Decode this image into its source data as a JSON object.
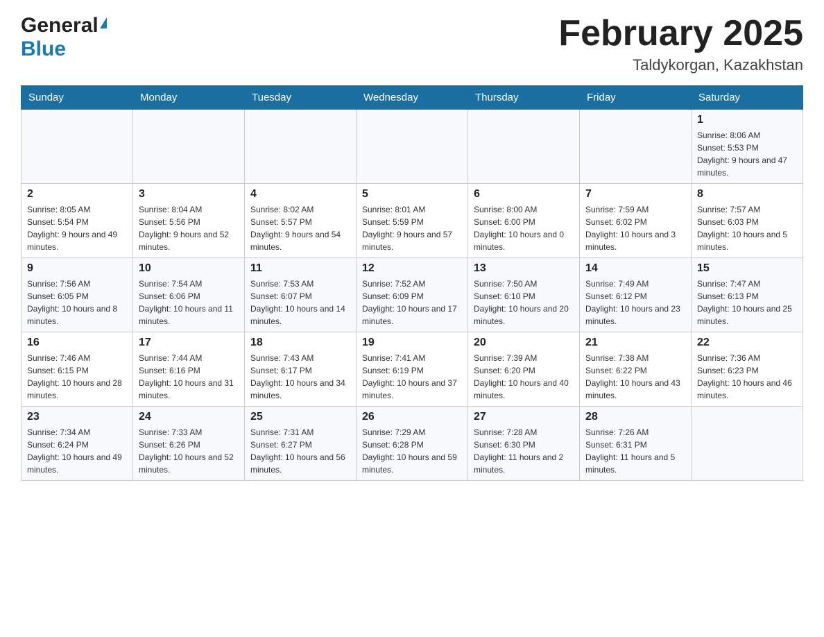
{
  "header": {
    "logo_general": "General",
    "logo_blue": "Blue",
    "title": "February 2025",
    "subtitle": "Taldykorgan, Kazakhstan"
  },
  "days_of_week": [
    "Sunday",
    "Monday",
    "Tuesday",
    "Wednesday",
    "Thursday",
    "Friday",
    "Saturday"
  ],
  "weeks": [
    [
      {
        "day": "",
        "info": ""
      },
      {
        "day": "",
        "info": ""
      },
      {
        "day": "",
        "info": ""
      },
      {
        "day": "",
        "info": ""
      },
      {
        "day": "",
        "info": ""
      },
      {
        "day": "",
        "info": ""
      },
      {
        "day": "1",
        "info": "Sunrise: 8:06 AM\nSunset: 5:53 PM\nDaylight: 9 hours and 47 minutes."
      }
    ],
    [
      {
        "day": "2",
        "info": "Sunrise: 8:05 AM\nSunset: 5:54 PM\nDaylight: 9 hours and 49 minutes."
      },
      {
        "day": "3",
        "info": "Sunrise: 8:04 AM\nSunset: 5:56 PM\nDaylight: 9 hours and 52 minutes."
      },
      {
        "day": "4",
        "info": "Sunrise: 8:02 AM\nSunset: 5:57 PM\nDaylight: 9 hours and 54 minutes."
      },
      {
        "day": "5",
        "info": "Sunrise: 8:01 AM\nSunset: 5:59 PM\nDaylight: 9 hours and 57 minutes."
      },
      {
        "day": "6",
        "info": "Sunrise: 8:00 AM\nSunset: 6:00 PM\nDaylight: 10 hours and 0 minutes."
      },
      {
        "day": "7",
        "info": "Sunrise: 7:59 AM\nSunset: 6:02 PM\nDaylight: 10 hours and 3 minutes."
      },
      {
        "day": "8",
        "info": "Sunrise: 7:57 AM\nSunset: 6:03 PM\nDaylight: 10 hours and 5 minutes."
      }
    ],
    [
      {
        "day": "9",
        "info": "Sunrise: 7:56 AM\nSunset: 6:05 PM\nDaylight: 10 hours and 8 minutes."
      },
      {
        "day": "10",
        "info": "Sunrise: 7:54 AM\nSunset: 6:06 PM\nDaylight: 10 hours and 11 minutes."
      },
      {
        "day": "11",
        "info": "Sunrise: 7:53 AM\nSunset: 6:07 PM\nDaylight: 10 hours and 14 minutes."
      },
      {
        "day": "12",
        "info": "Sunrise: 7:52 AM\nSunset: 6:09 PM\nDaylight: 10 hours and 17 minutes."
      },
      {
        "day": "13",
        "info": "Sunrise: 7:50 AM\nSunset: 6:10 PM\nDaylight: 10 hours and 20 minutes."
      },
      {
        "day": "14",
        "info": "Sunrise: 7:49 AM\nSunset: 6:12 PM\nDaylight: 10 hours and 23 minutes."
      },
      {
        "day": "15",
        "info": "Sunrise: 7:47 AM\nSunset: 6:13 PM\nDaylight: 10 hours and 25 minutes."
      }
    ],
    [
      {
        "day": "16",
        "info": "Sunrise: 7:46 AM\nSunset: 6:15 PM\nDaylight: 10 hours and 28 minutes."
      },
      {
        "day": "17",
        "info": "Sunrise: 7:44 AM\nSunset: 6:16 PM\nDaylight: 10 hours and 31 minutes."
      },
      {
        "day": "18",
        "info": "Sunrise: 7:43 AM\nSunset: 6:17 PM\nDaylight: 10 hours and 34 minutes."
      },
      {
        "day": "19",
        "info": "Sunrise: 7:41 AM\nSunset: 6:19 PM\nDaylight: 10 hours and 37 minutes."
      },
      {
        "day": "20",
        "info": "Sunrise: 7:39 AM\nSunset: 6:20 PM\nDaylight: 10 hours and 40 minutes."
      },
      {
        "day": "21",
        "info": "Sunrise: 7:38 AM\nSunset: 6:22 PM\nDaylight: 10 hours and 43 minutes."
      },
      {
        "day": "22",
        "info": "Sunrise: 7:36 AM\nSunset: 6:23 PM\nDaylight: 10 hours and 46 minutes."
      }
    ],
    [
      {
        "day": "23",
        "info": "Sunrise: 7:34 AM\nSunset: 6:24 PM\nDaylight: 10 hours and 49 minutes."
      },
      {
        "day": "24",
        "info": "Sunrise: 7:33 AM\nSunset: 6:26 PM\nDaylight: 10 hours and 52 minutes."
      },
      {
        "day": "25",
        "info": "Sunrise: 7:31 AM\nSunset: 6:27 PM\nDaylight: 10 hours and 56 minutes."
      },
      {
        "day": "26",
        "info": "Sunrise: 7:29 AM\nSunset: 6:28 PM\nDaylight: 10 hours and 59 minutes."
      },
      {
        "day": "27",
        "info": "Sunrise: 7:28 AM\nSunset: 6:30 PM\nDaylight: 11 hours and 2 minutes."
      },
      {
        "day": "28",
        "info": "Sunrise: 7:26 AM\nSunset: 6:31 PM\nDaylight: 11 hours and 5 minutes."
      },
      {
        "day": "",
        "info": ""
      }
    ]
  ]
}
